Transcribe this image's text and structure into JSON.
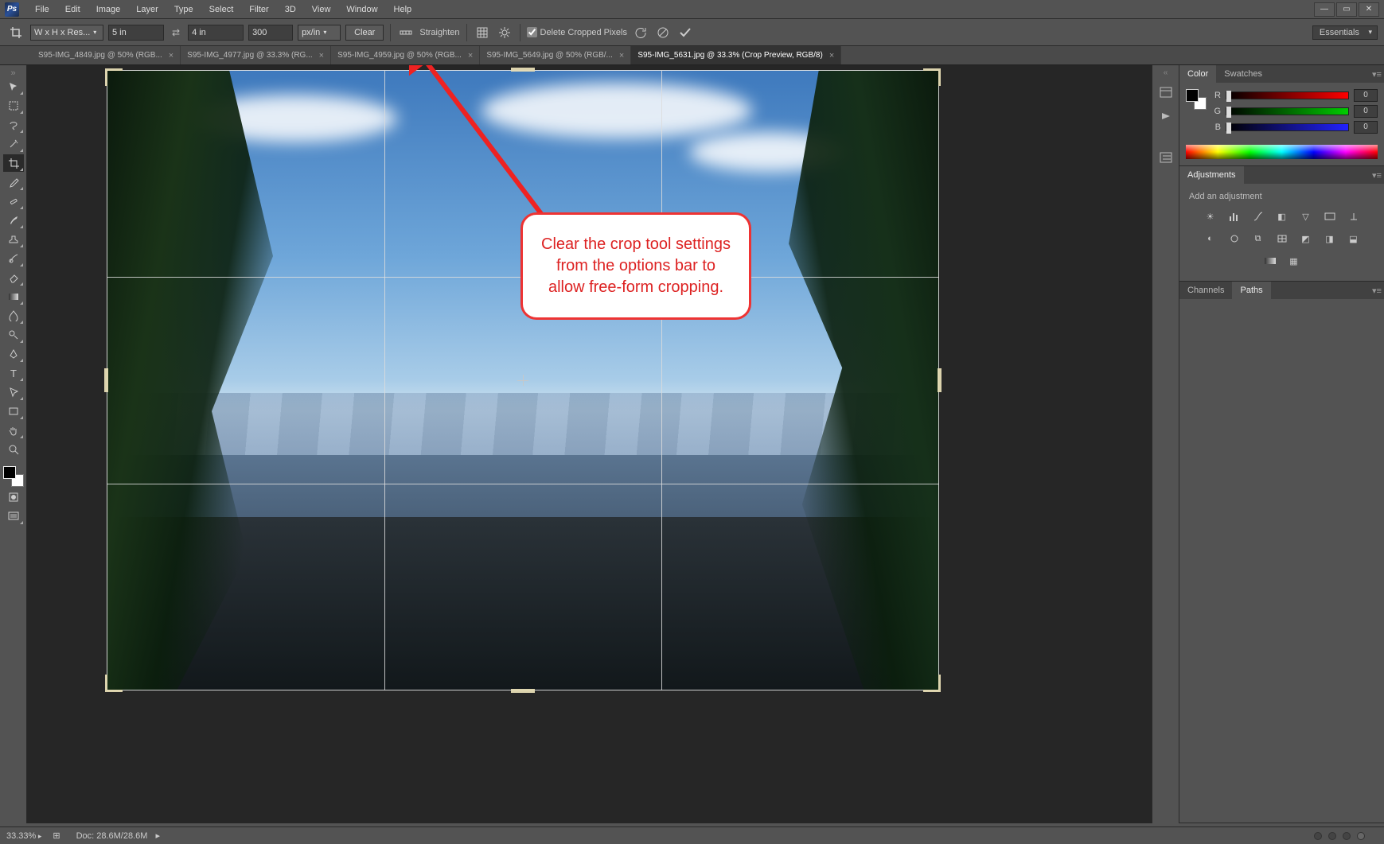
{
  "menu": {
    "items": [
      "File",
      "Edit",
      "Image",
      "Layer",
      "Type",
      "Select",
      "Filter",
      "3D",
      "View",
      "Window",
      "Help"
    ]
  },
  "window_controls": {
    "min": "—",
    "max": "▭",
    "close": "✕"
  },
  "options": {
    "preset": "W x H x Res...",
    "width": "5 in",
    "height": "4 in",
    "resolution": "300",
    "res_unit": "px/in",
    "clear": "Clear",
    "straighten": "Straighten",
    "delete_cropped": "Delete Cropped Pixels",
    "swap": "⇄"
  },
  "workspace": "Essentials",
  "tabs": [
    {
      "label": "S95-IMG_4849.jpg @ 50% (RGB...",
      "active": false
    },
    {
      "label": "S95-IMG_4977.jpg @ 33.3% (RG...",
      "active": false
    },
    {
      "label": "S95-IMG_4959.jpg @ 50% (RGB...",
      "active": false
    },
    {
      "label": "S95-IMG_5649.jpg @ 50% (RGB/...",
      "active": false
    },
    {
      "label": "S95-IMG_5631.jpg @ 33.3% (Crop Preview, RGB/8)",
      "active": true
    }
  ],
  "tools": [
    "move",
    "marquee",
    "lasso",
    "wand",
    "crop",
    "eyedropper",
    "heal",
    "brush",
    "stamp",
    "history-brush",
    "eraser",
    "gradient",
    "blur",
    "dodge",
    "pen",
    "type",
    "path-select",
    "shape",
    "hand",
    "zoom"
  ],
  "panels": {
    "color": {
      "tabs": [
        "Color",
        "Swatches"
      ],
      "r": "0",
      "g": "0",
      "b": "0"
    },
    "adjustments": {
      "tab": "Adjustments",
      "hint": "Add an adjustment"
    },
    "paths": {
      "tabs": [
        "Channels",
        "Paths"
      ],
      "active": "Paths"
    }
  },
  "callout": "Clear the crop tool settings from the options bar to allow free-form cropping.",
  "status": {
    "zoom": "33.33%",
    "doc": "Doc: 28.6M/28.6M"
  }
}
